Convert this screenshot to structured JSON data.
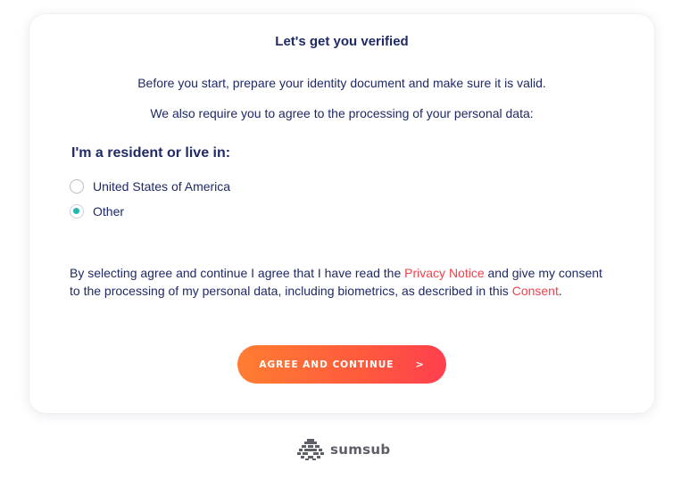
{
  "dialog": {
    "title": "Let's get you verified",
    "intro_line1": "Before you start, prepare your identity document and make sure it is valid.",
    "intro_line2": "We also require you to agree to the processing of your personal data:"
  },
  "residency": {
    "heading": "I'm a resident or live in:",
    "options": [
      {
        "label": "United States of America",
        "selected": false
      },
      {
        "label": "Other",
        "selected": true
      }
    ]
  },
  "consent": {
    "text_part1": "By selecting agree and continue I agree that I have read the ",
    "privacy_link": "Privacy Notice",
    "text_part2": " and give my consent to the processing of my personal data, including biometrics, as described in this ",
    "consent_link": "Consent",
    "text_part3": "."
  },
  "cta": {
    "label": "AGREE AND CONTINUE",
    "arrow": ">"
  },
  "brand": {
    "name": "sumsub",
    "logo_icon": "sumsub-logo-icon"
  },
  "colors": {
    "text": "#1f2a66",
    "link": "#f0434a",
    "radio_selected": "#20b9b0",
    "cta_gradient_start": "#ff7d31",
    "cta_gradient_end": "#ff3f4e",
    "brand_text": "#5d5f66"
  }
}
